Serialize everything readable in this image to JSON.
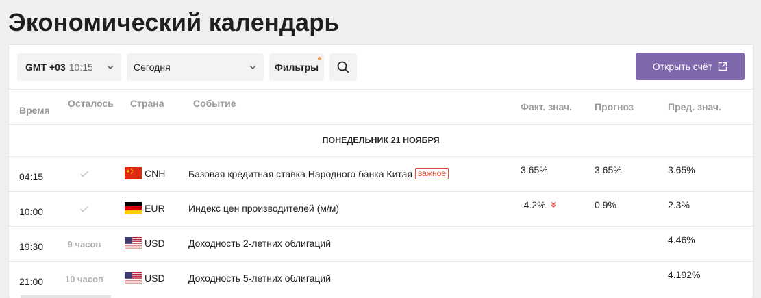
{
  "page_title": "Экономический календарь",
  "toolbar": {
    "timezone_label": "GMT +03",
    "timezone_time": "10:15",
    "day_select": "Сегодня",
    "filters_label": "Фильтры",
    "open_account_label": "Открыть счёт",
    "accent_color": "#8068ad"
  },
  "columns": {
    "time": "Время",
    "remaining": "Осталось",
    "country": "Страна",
    "event": "Событие",
    "actual": "Факт. знач.",
    "forecast": "Прогноз",
    "previous": "Пред. знач."
  },
  "date_header": "ПОНЕДЕЛЬНИК 21 НОЯБРЯ",
  "events": [
    {
      "time": "04:15",
      "remaining": "",
      "done": true,
      "flag": "cn-flag",
      "currency": "CNH",
      "event": "Базовая кредитная ставка Народного банка Китая",
      "badge": "важное",
      "actual": "3.65%",
      "actual_trend": "",
      "forecast": "3.65%",
      "previous": "3.65%"
    },
    {
      "time": "10:00",
      "remaining": "",
      "done": true,
      "flag": "de-flag",
      "currency": "EUR",
      "event": "Индекс цен производителей (м/м)",
      "badge": "",
      "actual": "-4.2%",
      "actual_trend": "down",
      "forecast": "0.9%",
      "previous": "2.3%"
    },
    {
      "time": "19:30",
      "remaining": "9 часов",
      "done": false,
      "flag": "us-flag",
      "currency": "USD",
      "event": "Доходность 2-летних облигаций",
      "badge": "",
      "actual": "",
      "actual_trend": "",
      "forecast": "",
      "previous": "4.46%"
    },
    {
      "time": "21:00",
      "remaining": "10 часов",
      "done": false,
      "flag": "us-flag",
      "currency": "USD",
      "event": "Доходность 5-летних облигаций",
      "badge": "",
      "actual": "",
      "actual_trend": "",
      "forecast": "",
      "previous": "4.192%"
    }
  ]
}
